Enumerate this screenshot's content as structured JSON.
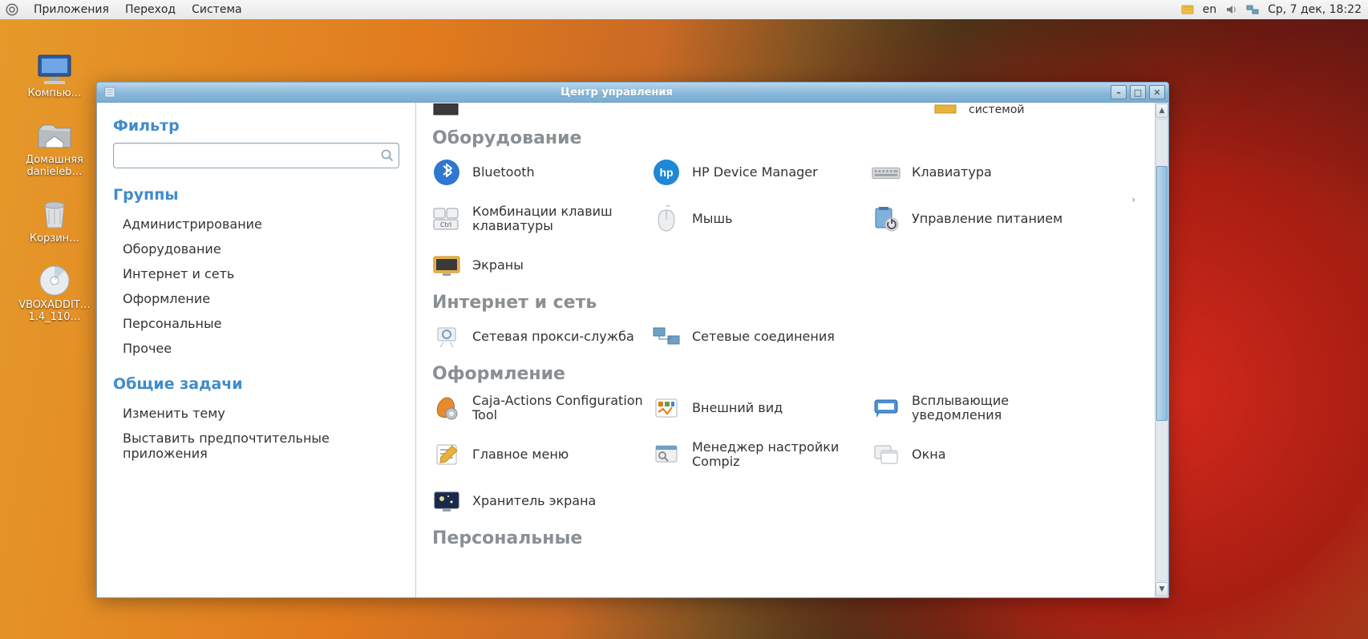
{
  "panel": {
    "menus": [
      "Приложения",
      "Переход",
      "Система"
    ],
    "lang": "en",
    "clock": "Ср,  7 дек, 18:22"
  },
  "desktop_icons": [
    {
      "id": "computer",
      "label": "Компью…"
    },
    {
      "id": "home",
      "label": "Домашняя\ndanieleb…"
    },
    {
      "id": "trash",
      "label": "Корзин…"
    },
    {
      "id": "disc",
      "label": "VBOXADDIT…\n1.4_110…"
    }
  ],
  "window": {
    "title": "Центр управления",
    "sidebar": {
      "filter_heading": "Фильтр",
      "search_value": "",
      "groups_heading": "Группы",
      "groups": [
        "Администрирование",
        "Оборудование",
        "Интернет и сеть",
        "Оформление",
        "Персональные",
        "Прочее"
      ],
      "tasks_heading": "Общие задачи",
      "tasks": [
        "Изменить тему",
        "Выставить предпочтительные приложения"
      ]
    },
    "partial_top": {
      "right_label": "системой"
    },
    "categories": [
      {
        "id": "hardware",
        "title": "Оборудование",
        "items": [
          {
            "icon": "bluetooth",
            "label": "Bluetooth"
          },
          {
            "icon": "hp",
            "label": "HP Device Manager"
          },
          {
            "icon": "keyboard",
            "label": "Клавиатура"
          },
          {
            "icon": "shortcut",
            "label": "Комбинации клавиш клавиатуры"
          },
          {
            "icon": "mouse",
            "label": "Мышь"
          },
          {
            "icon": "power",
            "label": "Управление питанием"
          },
          {
            "icon": "screens",
            "label": "Экраны"
          }
        ]
      },
      {
        "id": "network",
        "title": "Интернет и сеть",
        "items": [
          {
            "icon": "proxy",
            "label": "Сетевая прокси-служба"
          },
          {
            "icon": "netconn",
            "label": "Сетевые соединения"
          }
        ]
      },
      {
        "id": "appearance",
        "title": "Оформление",
        "items": [
          {
            "icon": "caja",
            "label": "Caja-Actions Configuration Tool"
          },
          {
            "icon": "look",
            "label": "Внешний вид"
          },
          {
            "icon": "notify",
            "label": "Всплывающие уведомления"
          },
          {
            "icon": "menu",
            "label": "Главное меню"
          },
          {
            "icon": "compiz",
            "label": "Менеджер настройки Compiz"
          },
          {
            "icon": "windows",
            "label": "Окна"
          },
          {
            "icon": "saver",
            "label": "Хранитель экрана"
          }
        ]
      },
      {
        "id": "personal",
        "title": "Персональные",
        "items": []
      }
    ]
  },
  "colors": {
    "accent": "#3f8ccc",
    "title_fg": "#ffffff",
    "category_fg": "#8a8f93"
  }
}
